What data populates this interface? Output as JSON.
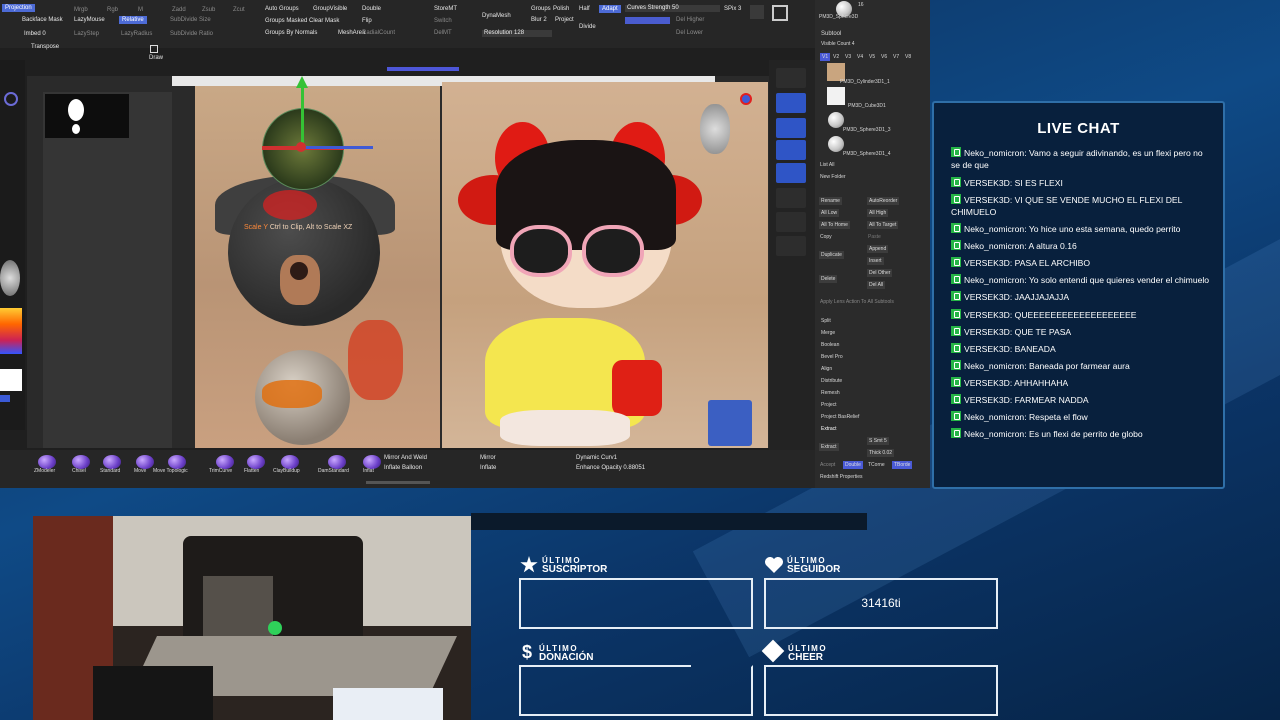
{
  "zbrush": {
    "top_labels": [
      "Backface Mask",
      "LazyMouse",
      "Relative",
      "SubDivide Size",
      "Imbed 0",
      "LazyStep",
      "LazyRadius",
      "SubDivide Ratio",
      "Transpose",
      "Auto Groups",
      "GroupVisible",
      "Double",
      "Groups Masked Clear Mask",
      "Flip",
      "Groups By Normals",
      "MeshArea",
      "RadialCount",
      "StoreMT",
      "DynaMesh",
      "Resolution 128",
      "Switch",
      "DelMT",
      "Groups",
      "Polish",
      "Half",
      "Adapt",
      "Blur 2",
      "Project",
      "Divide",
      "Curves Strength 50",
      "SPix 3",
      "Del Higher",
      "Del Lower",
      "Mrgb",
      "Rgb",
      "M",
      "Zadd",
      "Zsub",
      "Zcut"
    ],
    "draw_label": "Draw",
    "hint_accent": "Scale Y",
    "hint_text": "Ctrl to Clip, Alt to Scale XZ",
    "brushes": [
      "ZModeler",
      "Chisel",
      "Standard",
      "Move",
      "Move Topologic",
      "TrimCurve",
      "Flatten",
      "ClayBuildup",
      "DamStandard",
      "Inflat"
    ],
    "bottom_controls": [
      "Mirror And Weld",
      "Inflate Balloon",
      "Mirror",
      "Inflate",
      "Dynamic Curv1",
      "Enhance Opacity 0.88051"
    ],
    "subtool": {
      "header_number": "16",
      "header_name": "PM3D_Sphere3D",
      "title": "Subtool",
      "visible_count": "Visible Count 4",
      "version_tabs": [
        "V1",
        "V2",
        "V3",
        "V4",
        "V5",
        "V6",
        "V7",
        "V8"
      ],
      "items": [
        "PM3D_Cylinder3D1_1",
        "PM3D_Cube3D1",
        "PM3D_Sphere3D1_3",
        "PM3D_Sphere3D1_4"
      ],
      "actions": [
        "List All",
        "New Folder",
        "Rename",
        "AutoReorder",
        "All Low",
        "All High",
        "All To Home",
        "All To Target",
        "Copy",
        "Paste",
        "Duplicate",
        "Append",
        "Insert",
        "Delete",
        "Del Other",
        "Del All",
        "Apply Lens Action To All Subtools"
      ],
      "sections": [
        "Split",
        "Merge",
        "Boolean",
        "Bevel Pro",
        "Align",
        "Distribute",
        "Remesh",
        "Project",
        "Project BasRelief",
        "Extract"
      ],
      "extract_controls": [
        "Extract",
        "S Smt 5",
        "Thick 0.02",
        "Accept",
        "Double",
        "TCorne",
        "TBorde",
        "Redshift Properties"
      ]
    }
  },
  "chat": {
    "title": "LIVE CHAT",
    "messages": [
      {
        "user": "Neko_nomicron",
        "text": "Vamo a seguir adivinando, es un flexi pero no se de que"
      },
      {
        "user": "VERSEK3D",
        "text": "SI ES FLEXI"
      },
      {
        "user": "VERSEK3D",
        "text": "VI QUE SE VENDE MUCHO EL FLEXI DEL CHIMUELO"
      },
      {
        "user": "Neko_nomicron",
        "text": "Yo hice uno esta semana, quedo perrito"
      },
      {
        "user": "Neko_nomicron",
        "text": "A altura 0.16"
      },
      {
        "user": "VERSEK3D",
        "text": "PASA EL ARCHIBO"
      },
      {
        "user": "Neko_nomicron",
        "text": "Yo solo entendi que quieres vender el chimuelo"
      },
      {
        "user": "VERSEK3D",
        "text": "JAAJJAJAJJA"
      },
      {
        "user": "VERSEK3D",
        "text": "QUEEEEEEEEEEEEEEEEEEE"
      },
      {
        "user": "VERSEK3D",
        "text": "QUE TE PASA"
      },
      {
        "user": "VERSEK3D",
        "text": "BANEADA"
      },
      {
        "user": "Neko_nomicron",
        "text": "Baneada por farmear aura"
      },
      {
        "user": "VERSEK3D",
        "text": "AHHAHHAHA"
      },
      {
        "user": "VERSEK3D",
        "text": "FARMEAR NADDA"
      },
      {
        "user": "Neko_nomicron",
        "text": "Respeta el flow"
      },
      {
        "user": "Neko_nomicron",
        "text": "Es un flexi de perrito de globo"
      }
    ]
  },
  "stats": {
    "subscriber": {
      "small": "ÚLTIMO",
      "big": "SUSCRIPTOR",
      "value": "",
      "icon": "star-icon"
    },
    "follower": {
      "small": "ÚLTIMO",
      "big": "SEGUIDOR",
      "value": "31416ti",
      "icon": "heart-icon"
    },
    "donation": {
      "small": "ÚLTIMO",
      "big": "DONACIÓN",
      "value": "",
      "icon": "dollar-icon"
    },
    "cheer": {
      "small": "ÚLTIMO",
      "big": "CHEER",
      "value": "",
      "icon": "diamond-icon"
    }
  },
  "colors": {
    "chat_icon": "#25b546",
    "accent_blue": "#4d6bd6",
    "chat_border": "#2f6fa8"
  }
}
